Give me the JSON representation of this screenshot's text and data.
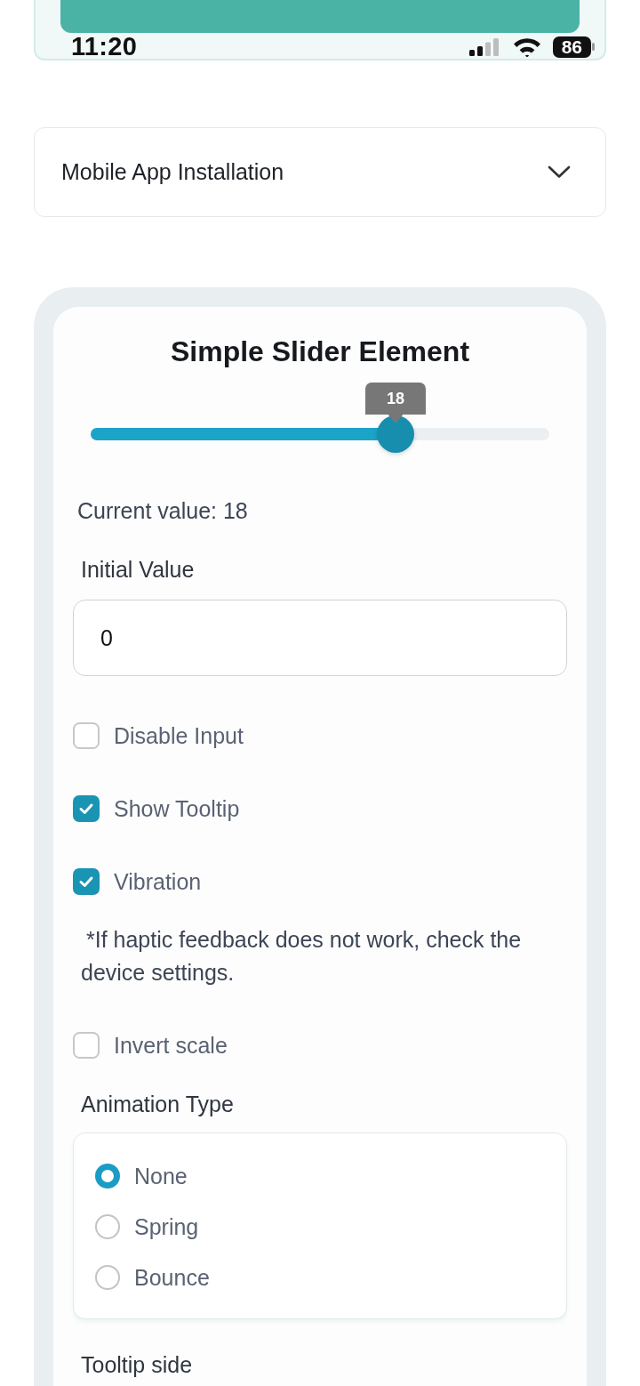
{
  "header": {
    "status_bar": {
      "time": "11:20",
      "battery": "86"
    }
  },
  "accordion": {
    "title": "Mobile App Installation",
    "expanded": false
  },
  "demo": {
    "title": "Simple Slider Element",
    "slider": {
      "tooltip": "18",
      "level": 0.665
    },
    "current_value": "Current value: 18",
    "initial_value": {
      "label": "Initial Value",
      "value": "0"
    },
    "options": [
      {
        "kind": "checkbox",
        "label": "Disable Input",
        "checked": false
      },
      {
        "kind": "checkbox",
        "label": "Show Tooltip",
        "checked": true
      },
      {
        "kind": "checkbox",
        "label": "Vibration",
        "checked": true
      },
      {
        "kind": "note",
        "text": "*If haptic feedback does not work, check the device settings."
      },
      {
        "kind": "checkbox",
        "label": "Invert scale",
        "checked": false
      }
    ],
    "animation_type": {
      "label": "Animation Type",
      "choices": [
        {
          "label": "None",
          "selected": true
        },
        {
          "label": "Spring",
          "selected": false
        },
        {
          "label": "Bounce",
          "selected": false
        }
      ]
    },
    "tooltip_side": {
      "label": "Tooltip side"
    }
  }
}
